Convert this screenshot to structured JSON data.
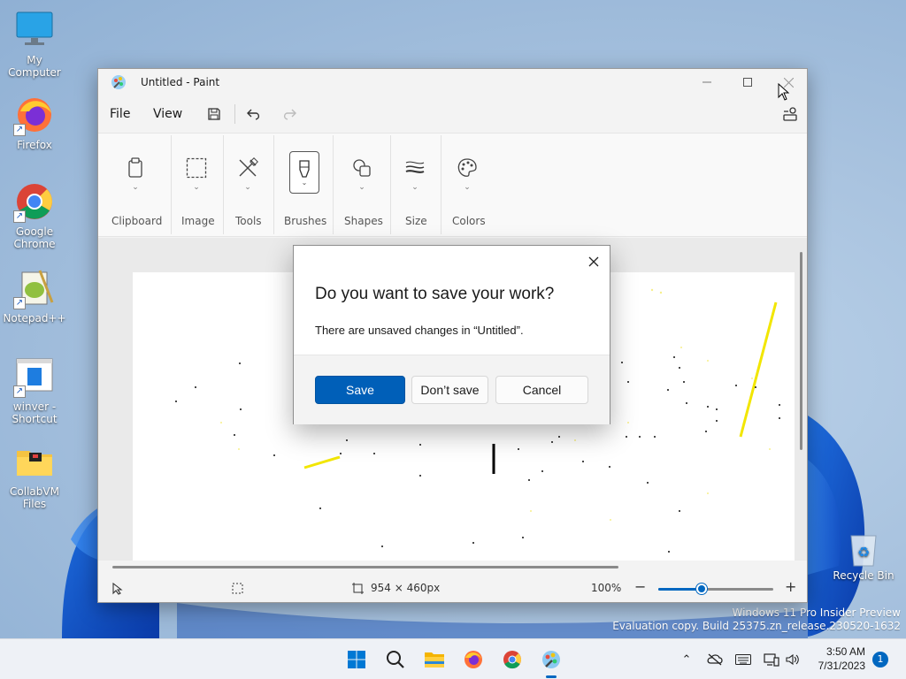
{
  "desktop": {
    "icons": [
      {
        "label": "My Computer",
        "icon": "monitor-icon"
      },
      {
        "label": "Firefox",
        "icon": "firefox-icon"
      },
      {
        "label": "Google Chrome",
        "icon": "chrome-icon"
      },
      {
        "label": "Notepad++",
        "icon": "notepadpp-icon"
      },
      {
        "label": "winver - Shortcut",
        "icon": "winver-icon"
      },
      {
        "label": "CollabVM Files",
        "icon": "folder-icon"
      }
    ],
    "recycle_bin": "Recycle Bin",
    "watermark": {
      "line1": "Windows 11 Pro Insider Preview",
      "line2": "Evaluation copy. Build 25375.zn_release.230520-1632"
    }
  },
  "paint": {
    "title": "Untitled - Paint",
    "menu": {
      "file": "File",
      "view": "View"
    },
    "ribbon": {
      "groups": [
        {
          "label": "Clipboard",
          "icon": "clipboard-icon"
        },
        {
          "label": "Image",
          "icon": "selection-icon"
        },
        {
          "label": "Tools",
          "icon": "tools-icon"
        },
        {
          "label": "Brushes",
          "icon": "brush-icon",
          "active": true
        },
        {
          "label": "Shapes",
          "icon": "shapes-icon"
        },
        {
          "label": "Size",
          "icon": "size-icon"
        },
        {
          "label": "Colors",
          "icon": "palette-icon"
        }
      ]
    },
    "status": {
      "canvas_size": "954 × 460px",
      "zoom": "100%",
      "zoom_level": 0.38
    },
    "colors": {
      "accent": "#005fb8",
      "stroke_yellow": "#f2e600",
      "stroke_black": "#000000"
    }
  },
  "dialog": {
    "title": "Do you want to save your work?",
    "message": "There are unsaved changes in “Untitled”.",
    "buttons": {
      "save": "Save",
      "dont_save": "Don’t save",
      "cancel": "Cancel"
    }
  },
  "taskbar": {
    "apps": [
      "start-icon",
      "search-icon",
      "file-explorer-icon",
      "firefox-icon",
      "chrome-icon",
      "paint-icon"
    ],
    "clock": {
      "time": "3:50 AM",
      "date": "7/31/2023"
    },
    "notification_count": "1"
  }
}
